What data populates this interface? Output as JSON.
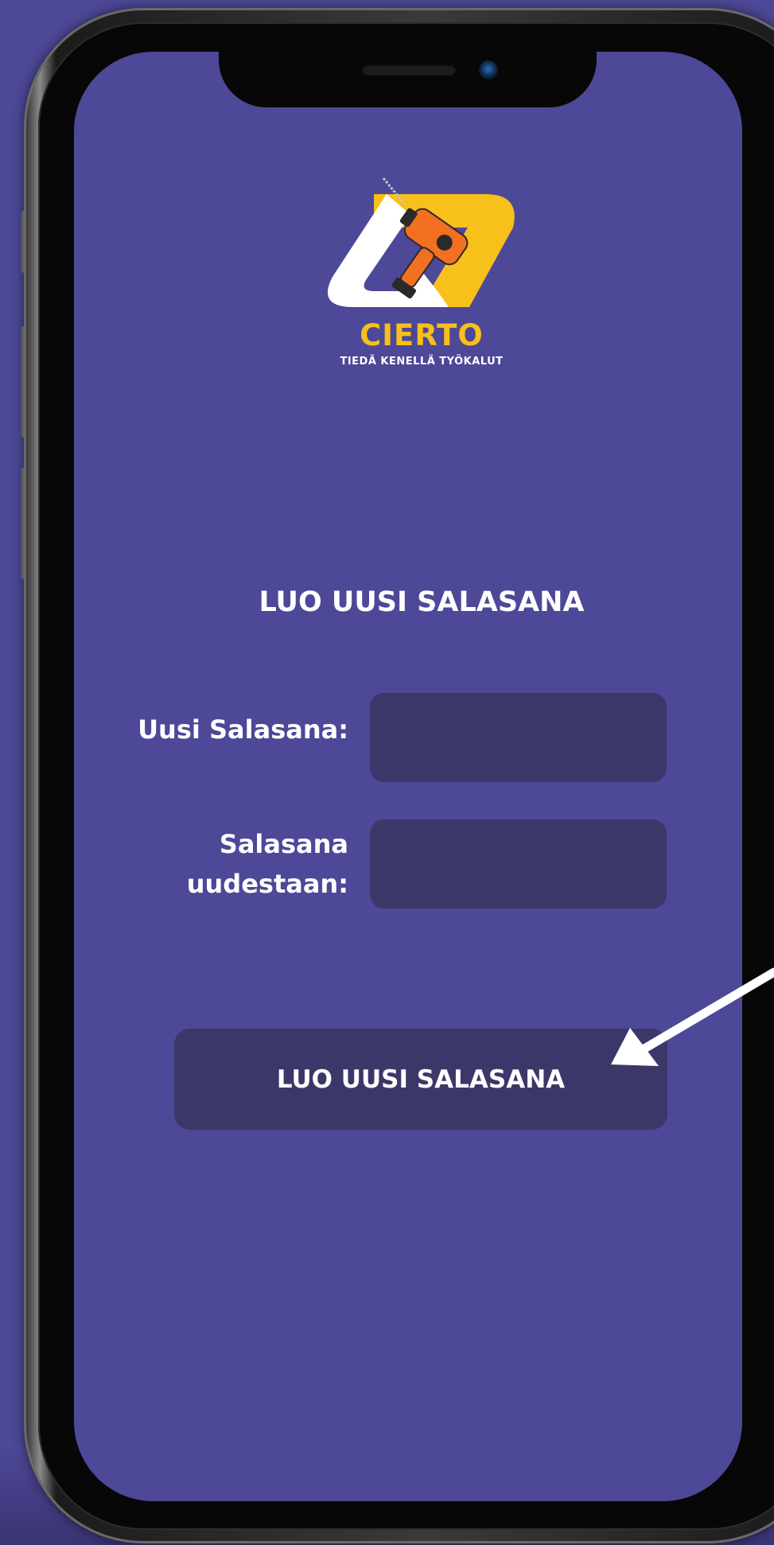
{
  "brand": {
    "name": "CIERTO",
    "tagline": "TIEDÄ KENELLÄ TYÖKALUT",
    "colors": {
      "accent_yellow": "#f7c01a",
      "accent_orange": "#f36f21",
      "logo_white": "#ffffff"
    }
  },
  "screen": {
    "background": "#4d4897",
    "title": "LUO UUSI SALASANA"
  },
  "form": {
    "new_password_label": "Uusi Salasana:",
    "confirm_password_label_line1": "Salasana",
    "confirm_password_label_line2": "uudestaan:",
    "new_password_value": "",
    "confirm_password_value": "",
    "field_color": "#3b3769",
    "submit_label": "LUO UUSI SALASANA"
  },
  "annotation": {
    "icon": "pointer-arrow-icon",
    "color": "#ffffff"
  }
}
